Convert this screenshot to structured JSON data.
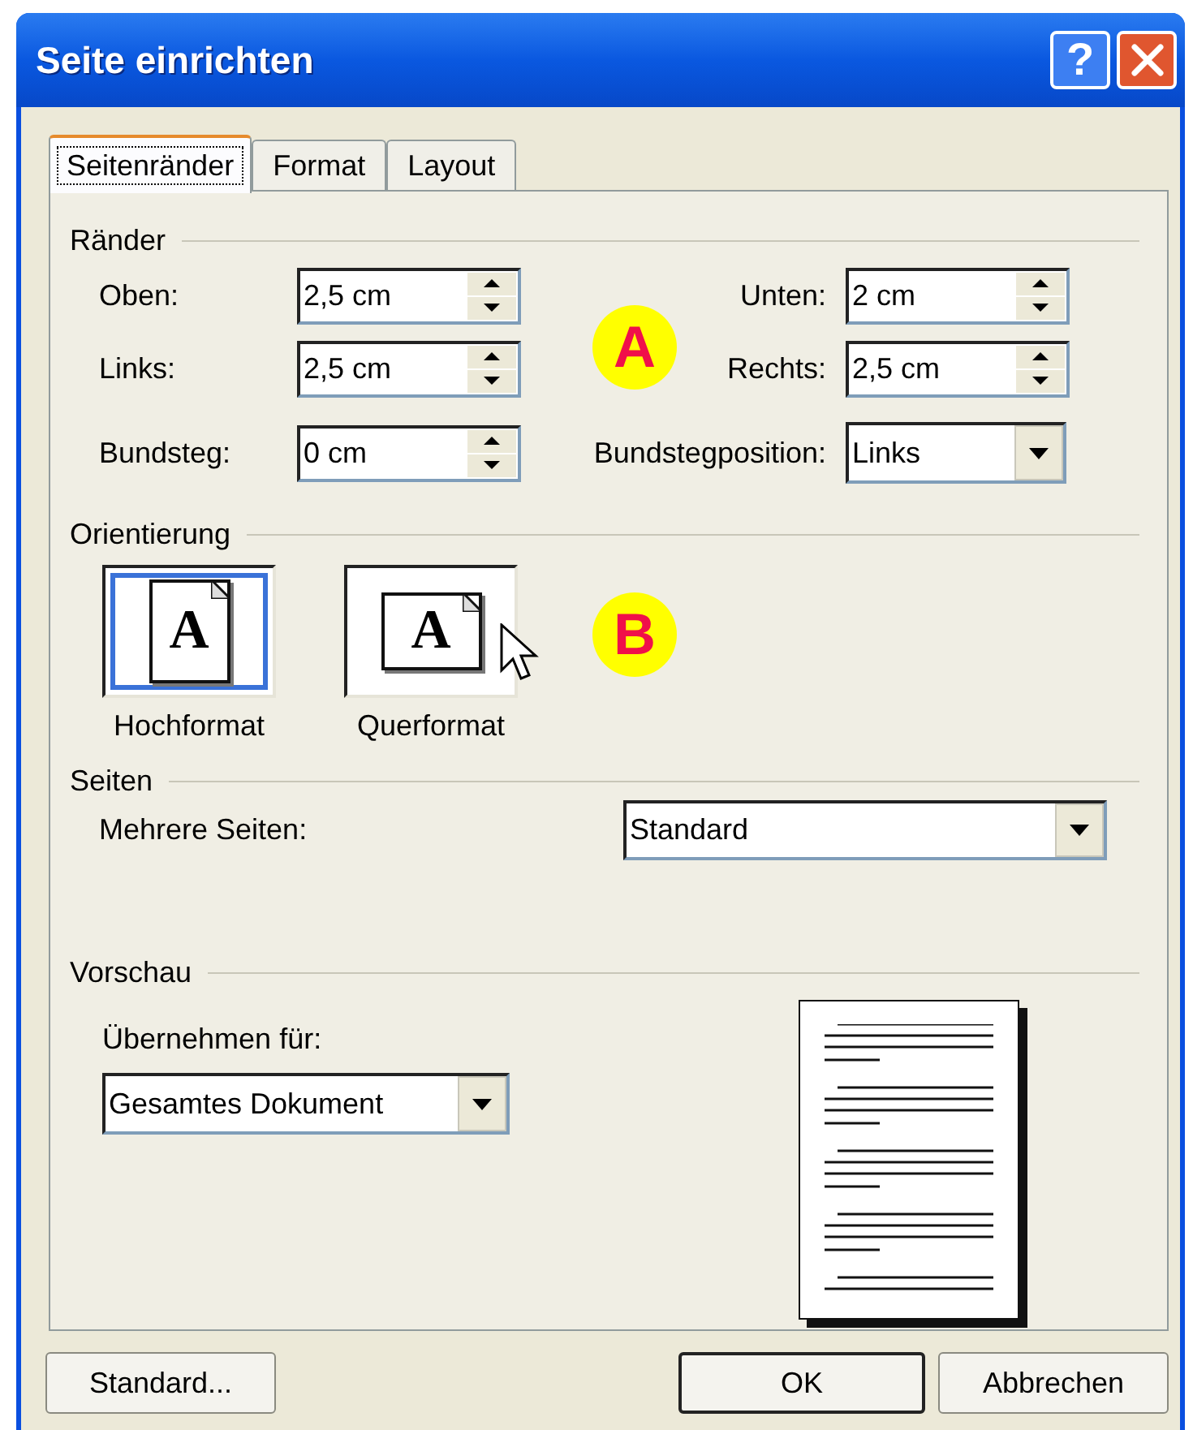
{
  "window": {
    "title": "Seite einrichten"
  },
  "title_buttons": [
    {
      "kind": "help",
      "text": "?"
    },
    {
      "kind": "close"
    }
  ],
  "tabs": [
    {
      "label": "Seitenränder",
      "selected": true
    },
    {
      "label": "Format",
      "selected": false
    },
    {
      "label": "Layout",
      "selected": false
    }
  ],
  "margins": {
    "title": "Ränder",
    "rows": [
      {
        "left": {
          "kind": "spin",
          "label": "Oben:",
          "value": "2,5 cm"
        },
        "right": {
          "kind": "spin",
          "label": "Unten:",
          "value": "2 cm"
        }
      },
      {
        "left": {
          "kind": "spin",
          "label": "Links:",
          "value": "2,5 cm"
        },
        "right": {
          "kind": "spin",
          "label": "Rechts:",
          "value": "2,5 cm"
        }
      },
      {
        "left": {
          "kind": "spin",
          "label": "Bundsteg:",
          "value": "0 cm"
        },
        "right": {
          "kind": "dropdown",
          "label": "Bundstegposition:",
          "value": "Links"
        }
      }
    ]
  },
  "orientation": {
    "title": "Orientierung",
    "options": [
      {
        "kind": "portrait",
        "glyph": "A",
        "label": "Hochformat",
        "selected": true
      },
      {
        "kind": "landscape",
        "glyph": "A",
        "label": "Querformat",
        "selected": false
      }
    ]
  },
  "markers": [
    {
      "label": "A"
    },
    {
      "label": "B"
    }
  ],
  "pages": {
    "title": "Seiten",
    "label": "Mehrere Seiten:",
    "value": "Standard"
  },
  "preview": {
    "title": "Vorschau",
    "apply_label": "Übernehmen für:",
    "apply_value": "Gesamtes Dokument"
  },
  "buttons": [
    {
      "label": "Standard...",
      "default": false
    },
    {
      "label": "OK",
      "default": true
    },
    {
      "label": "Abbrechen",
      "default": false
    }
  ]
}
